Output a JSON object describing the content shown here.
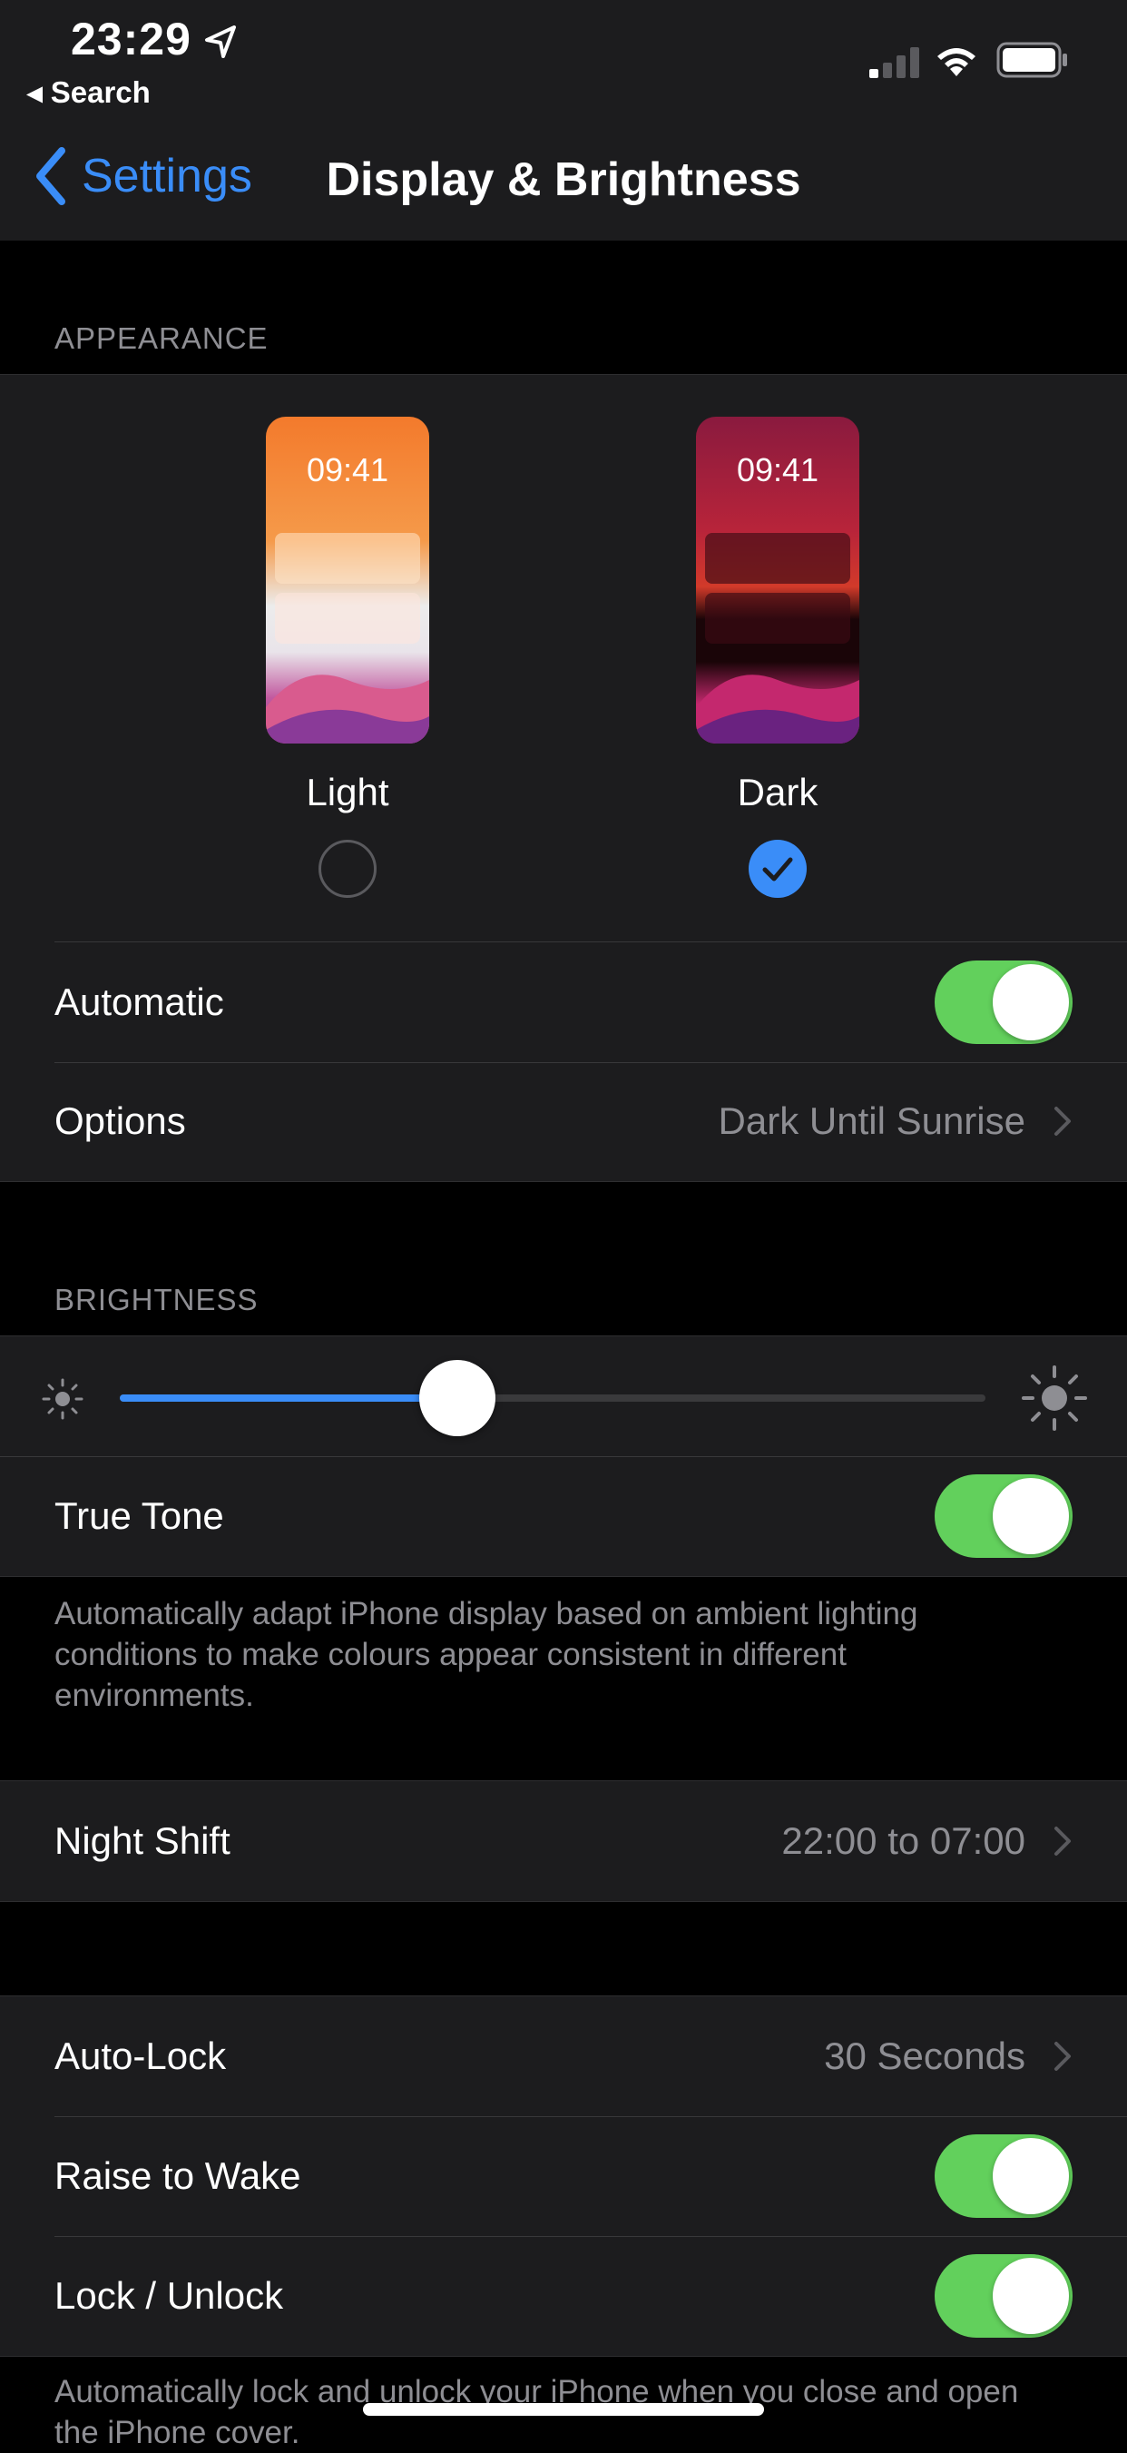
{
  "status_bar": {
    "time": "23:29",
    "back_app": "◂ Search",
    "icons": [
      "location-arrow-icon",
      "signal-icon",
      "wifi-icon",
      "battery-icon"
    ]
  },
  "nav": {
    "back_label": "Settings",
    "title": "Display & Brightness"
  },
  "appearance": {
    "header": "APPEARANCE",
    "light": {
      "preview_time": "09:41",
      "label": "Light",
      "selected": false
    },
    "dark": {
      "preview_time": "09:41",
      "label": "Dark",
      "selected": true
    },
    "automatic": {
      "label": "Automatic",
      "on": true
    },
    "options": {
      "label": "Options",
      "value": "Dark Until Sunrise"
    }
  },
  "brightness": {
    "header": "BRIGHTNESS",
    "level": 0.39,
    "true_tone": {
      "label": "True Tone",
      "on": true
    },
    "footnote": "Automatically adapt iPhone display based on ambient lighting conditions to make colours appear consistent in different environments."
  },
  "night_shift": {
    "label": "Night Shift",
    "value": "22:00 to 07:00"
  },
  "lock": {
    "auto_lock": {
      "label": "Auto-Lock",
      "value": "30 Seconds"
    },
    "raise_to_wake": {
      "label": "Raise to Wake",
      "on": true
    },
    "lock_unlock": {
      "label": "Lock / Unlock",
      "on": true
    },
    "footnote": "Automatically lock and unlock your iPhone when you close and open the iPhone cover."
  },
  "colors": {
    "accent": "#3a8df8",
    "toggle_on": "#62d05c",
    "group_bg": "#1c1c1e",
    "secondary_text": "#8e8e93"
  }
}
